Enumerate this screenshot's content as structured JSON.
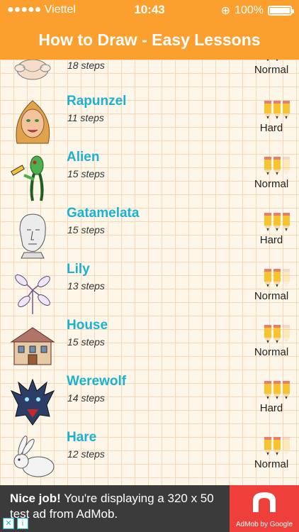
{
  "status": {
    "carrier": "●●●●● Viettel",
    "time": "10:43",
    "battery": "100%"
  },
  "header": {
    "title": "How to Draw - Easy Lessons"
  },
  "list": [
    {
      "title": "",
      "steps": "18 steps",
      "difficulty": "Normal",
      "pencils": 2,
      "icon": "baby-icon"
    },
    {
      "title": "Rapunzel",
      "steps": "11 steps",
      "difficulty": "Hard",
      "pencils": 3,
      "icon": "rapunzel-icon"
    },
    {
      "title": "Alien",
      "steps": "15 steps",
      "difficulty": "Normal",
      "pencils": 2,
      "icon": "alien-icon"
    },
    {
      "title": "Gatamelata",
      "steps": "15 steps",
      "difficulty": "Hard",
      "pencils": 3,
      "icon": "statue-head-icon"
    },
    {
      "title": "Lily",
      "steps": "13 steps",
      "difficulty": "Normal",
      "pencils": 2,
      "icon": "lily-flower-icon"
    },
    {
      "title": "House",
      "steps": "15 steps",
      "difficulty": "Normal",
      "pencils": 2,
      "icon": "house-icon"
    },
    {
      "title": "Werewolf",
      "steps": "14 steps",
      "difficulty": "Hard",
      "pencils": 3,
      "icon": "werewolf-icon"
    },
    {
      "title": "Hare",
      "steps": "12 steps",
      "difficulty": "Normal",
      "pencils": 2,
      "icon": "hare-icon"
    }
  ],
  "ad": {
    "headline": "Nice job!",
    "body": " You're displaying a 320 x 50 test ad from AdMob.",
    "brand": "AdMob by Google"
  }
}
